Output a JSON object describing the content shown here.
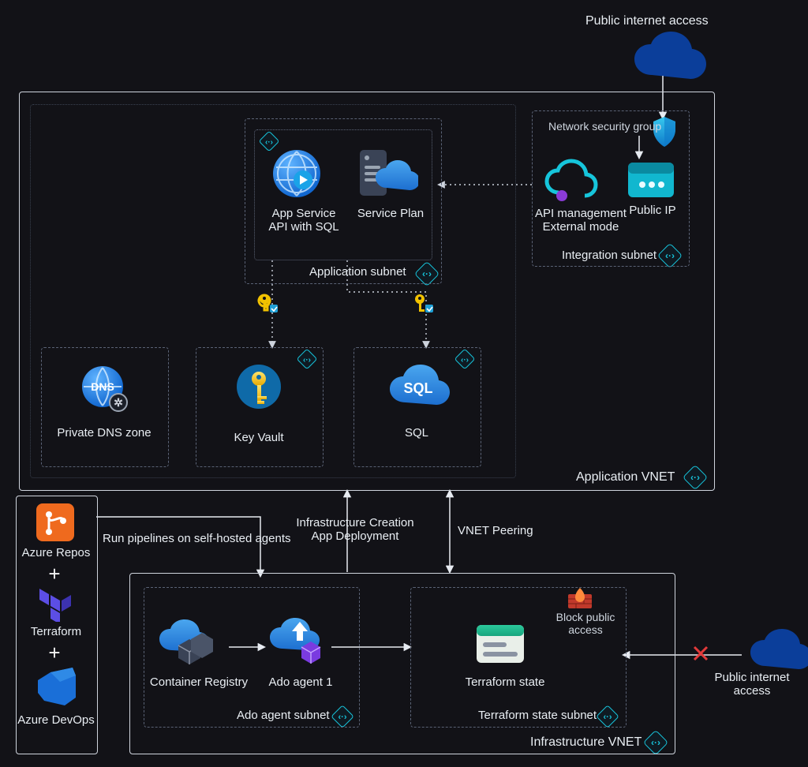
{
  "top": {
    "public_internet": "Public internet access"
  },
  "app_vnet": {
    "label": "Application VNET",
    "app_subnet": {
      "label": "Application subnet",
      "app_service": "App Service\nAPI with SQL",
      "service_plan": "Service Plan"
    },
    "integration_subnet": {
      "label": "Integration subnet",
      "nsg": "Network security group",
      "api_mgmt": "API management\nExternal mode",
      "public_ip": "Public IP"
    },
    "dns": "Private DNS zone",
    "keyvault": "Key Vault",
    "sql": "SQL"
  },
  "toolchain": {
    "repos": "Azure Repos",
    "terraform": "Terraform",
    "devops": "Azure DevOps"
  },
  "flows": {
    "run_pipelines": "Run pipelines on self-hosted agents",
    "infra_creation": "Infrastructure Creation\nApp Deployment",
    "vnet_peering": "VNET Peering"
  },
  "infra_vnet": {
    "label": "Infrastructure VNET",
    "ado_subnet": {
      "label": "Ado agent subnet",
      "registry": "Container Registry",
      "agent": "Ado agent 1"
    },
    "tf_subnet": {
      "label": "Terraform state subnet",
      "block": "Block public\naccess",
      "state": "Terraform state"
    }
  },
  "right": {
    "public_internet": "Public internet access"
  }
}
